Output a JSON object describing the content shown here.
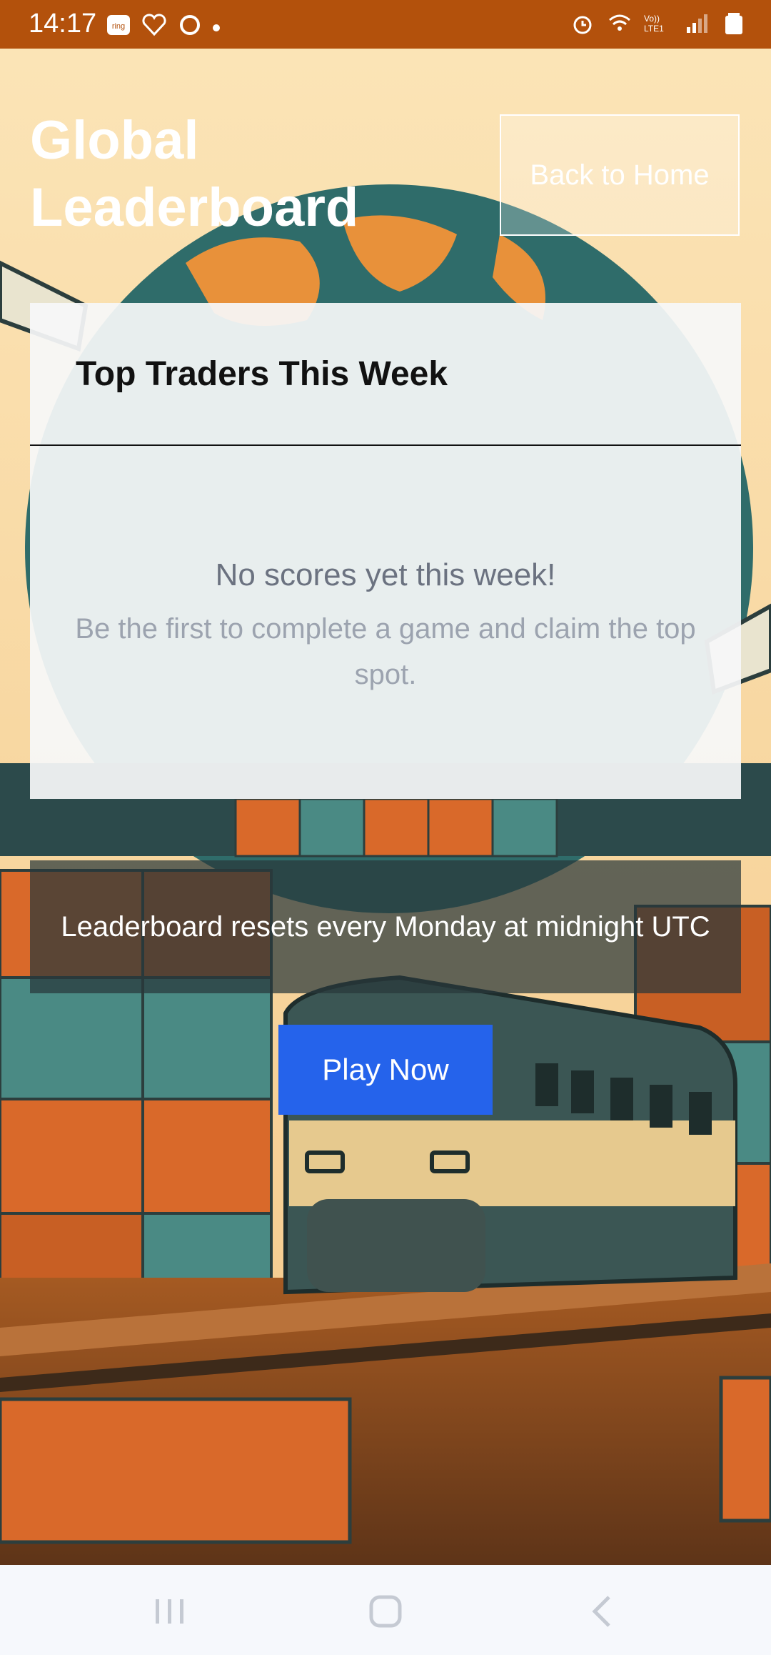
{
  "status_bar": {
    "time": "14:17",
    "left_icons": [
      "ring-app-icon",
      "heart-app-icon",
      "circle-app-icon",
      "notification-dot-icon"
    ],
    "right_icons": [
      "alarm-icon",
      "wifi-icon",
      "volte-icon",
      "signal-icon",
      "battery-icon"
    ],
    "volte_text": "Vo)) LTE1",
    "background_color": "#b3510c"
  },
  "header": {
    "title": "Global Leaderboard",
    "back_button_label": "Back to Home"
  },
  "card": {
    "title": "Top Traders This Week",
    "empty_title": "No scores yet this week!",
    "empty_subtitle": "Be the first to complete a game and claim the top spot."
  },
  "reset_notice": "Leaderboard resets every Monday at midnight UTC",
  "play_button_label": "Play Now",
  "colors": {
    "accent": "#2563eb",
    "container_orange": "#d9692a",
    "container_teal": "#4a8a84"
  },
  "nav_bar": {
    "items": [
      "recents-icon",
      "home-icon",
      "back-icon"
    ]
  }
}
